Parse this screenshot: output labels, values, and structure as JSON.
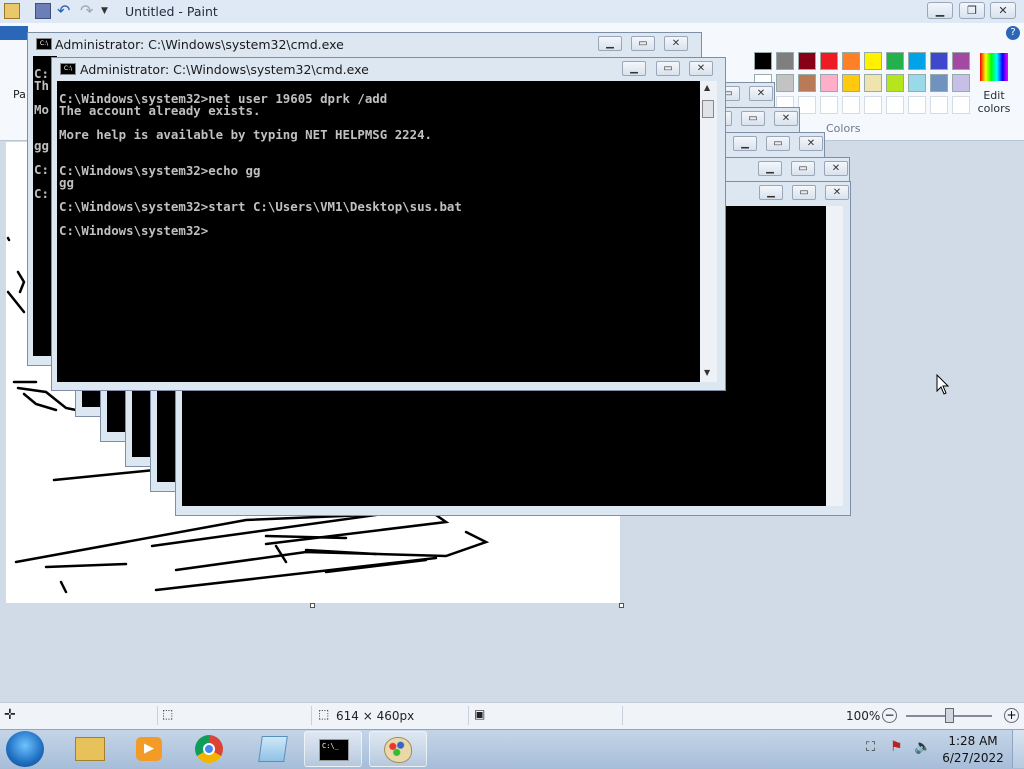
{
  "paint": {
    "title": "Untitled - Paint",
    "ribbon_stub_labels": [
      "Pa"
    ],
    "colors_label": "Colors",
    "edit_colors_label": "Edit colors",
    "palette_row1": [
      "#000000",
      "#7f7f7f",
      "#880015",
      "#ed1c24",
      "#ff7f27",
      "#fff200",
      "#22b14c",
      "#00a2e8",
      "#3f48cc",
      "#a349a4"
    ],
    "palette_row2": [
      "#ffffff",
      "#c3c3c3",
      "#b97a57",
      "#ffaec9",
      "#ffc90e",
      "#efe4b0",
      "#b5e61d",
      "#99d9ea",
      "#7092be",
      "#c8bfe7"
    ],
    "status": {
      "size": "614 × 460px",
      "zoom": "100%"
    }
  },
  "cmd_front": {
    "title": "Administrator: C:\\Windows\\system32\\cmd.exe",
    "lines": [
      "C:\\Windows\\system32>net user 19605 dprk /add",
      "The account already exists.",
      "",
      "More help is available by typing NET HELPMSG 2224.",
      "",
      "",
      "C:\\Windows\\system32>echo gg",
      "gg",
      "",
      "C:\\Windows\\system32>start C:\\Users\\VM1\\Desktop\\sus.bat",
      "",
      "C:\\Windows\\system32>"
    ]
  },
  "cmd_back": {
    "title": "Administrator: C:\\Windows\\system32\\cmd.exe",
    "partial_lines": [
      "C:",
      "Th",
      "",
      "Mo",
      "",
      "",
      "gg",
      "",
      "C:",
      "",
      "C:"
    ]
  },
  "taskbar": {
    "time": "1:28 AM",
    "date": "6/27/2022",
    "apps": [
      "explorer",
      "media-player",
      "chrome",
      "notepad",
      "cmd",
      "paint"
    ]
  }
}
